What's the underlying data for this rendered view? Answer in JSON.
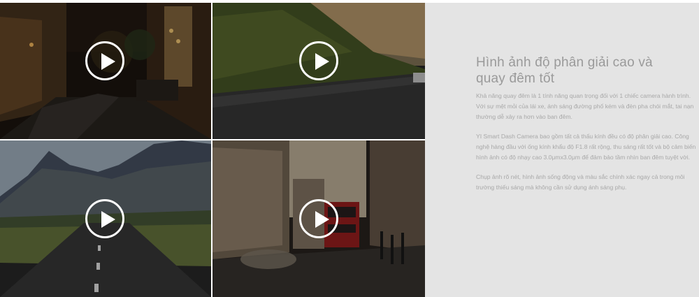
{
  "section": {
    "heading": "Hình ảnh độ phân giải cao và quay đêm tốt",
    "paragraphs": [
      "Khả năng quay đêm là 1 tính năng quan trọng đối với 1 chiếc camera hành trình. Với sự mệt mỏi của lái xe, ánh sáng đường phố kém và đèn pha chói mắt, tai nạn thường dễ xảy ra hơn vào ban đêm.",
      "YI Smart Dash Camera bao gồm tất cả thấu kính đều có độ phân giải cao. Công nghệ hàng đầu với ống kính khẩu độ F1.8 rất rộng, thu sáng rất tốt và bộ cảm biến hình ảnh có độ nhạy cao 3.0μmx3.0μm để đảm bảo tầm nhìn ban đêm tuyệt vời.",
      "Chụp ảnh rõ nét, hình ảnh sống động và màu sắc chính xác ngay cả trong môi trường thiếu sáng mà không cần sử dụng ánh sáng phụ."
    ]
  },
  "videos": [
    {
      "scene": "night-street",
      "icon": "play-icon"
    },
    {
      "scene": "hillside-road",
      "icon": "play-icon"
    },
    {
      "scene": "mountain-road",
      "icon": "play-icon"
    },
    {
      "scene": "city-bus-street",
      "icon": "play-icon"
    }
  ],
  "colors": {
    "panel_background": "#e4e4e4",
    "heading": "#9a9a9a",
    "body_text": "#a8a8a8",
    "play_button": "#ffffff"
  }
}
